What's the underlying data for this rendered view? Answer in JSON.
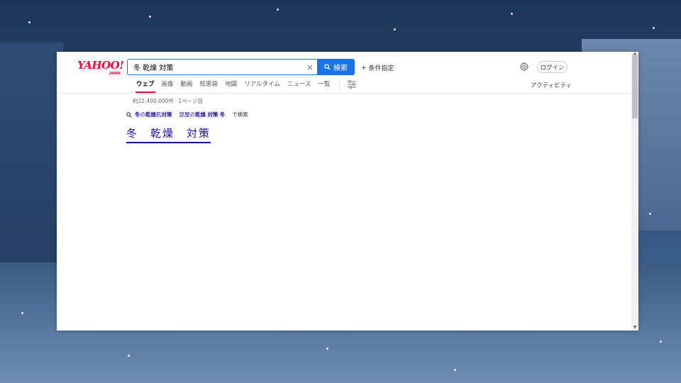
{
  "logo": {
    "main": "YAHOO!",
    "sub": "JAPAN"
  },
  "search": {
    "query": "冬 乾燥 対策",
    "button_label": "検索",
    "clear_symbol": "×"
  },
  "condition": {
    "label": "条件指定"
  },
  "header": {
    "login_label": "ログイン"
  },
  "tabs": [
    {
      "label": "ウェブ",
      "active": true
    },
    {
      "label": "画像"
    },
    {
      "label": "動画"
    },
    {
      "label": "知恵袋"
    },
    {
      "label": "地図"
    },
    {
      "label": "リアルタイム"
    },
    {
      "label": "ニュース"
    },
    {
      "label": "一覧"
    }
  ],
  "activity_label": "アクティビティ",
  "results": {
    "count_text": "約22,400,000件",
    "page_text": "1ページ目",
    "suggestions": [
      {
        "parts": [
          {
            "t": "冬",
            "b": true
          },
          {
            "t": "の",
            "b": false
          },
          {
            "t": "乾燥",
            "b": true
          },
          {
            "t": "肌",
            "b": false
          },
          {
            "t": "対策",
            "b": true
          }
        ]
      },
      {
        "parts": [
          {
            "t": "部屋の",
            "b": false
          },
          {
            "t": "乾燥",
            "b": true
          },
          {
            "t": " ",
            "b": false
          },
          {
            "t": "対策",
            "b": true
          },
          {
            "t": " ",
            "b": false
          },
          {
            "t": "冬",
            "b": true
          }
        ]
      }
    ],
    "suggest_suffix": "で検索",
    "title": "冬　乾燥　対策"
  },
  "colors": {
    "accent": "#1a73e8",
    "brand": "#ff0033",
    "link": "#1a0dab"
  }
}
